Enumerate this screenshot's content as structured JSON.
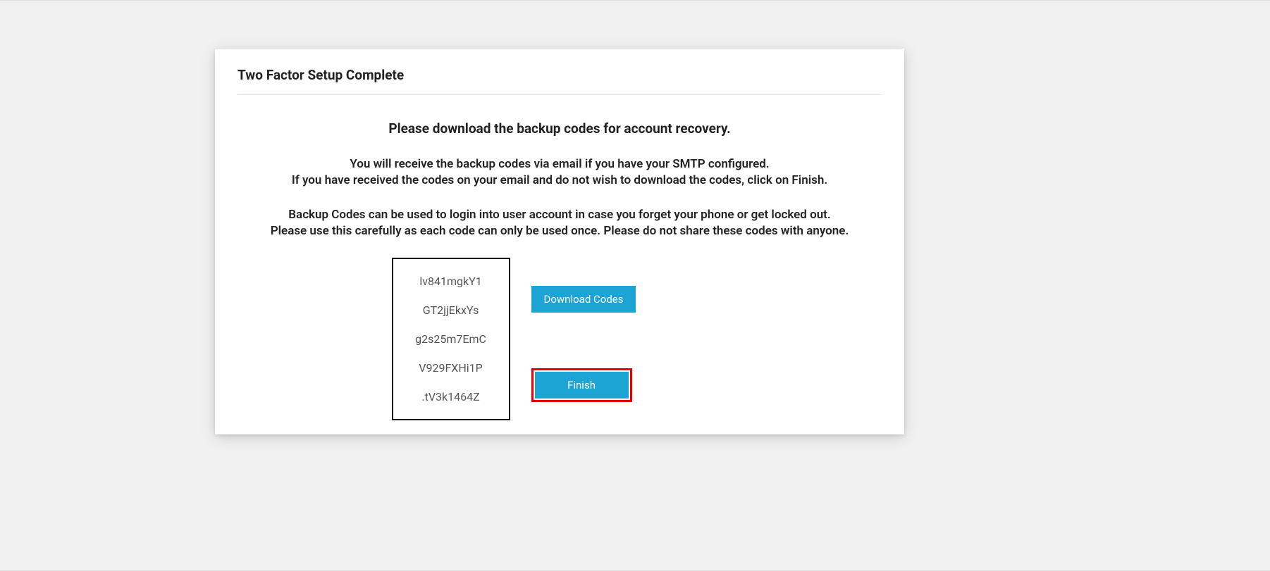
{
  "header": {
    "title": "Two Factor Setup Complete"
  },
  "intro": {
    "heading": "Please download the backup codes for account recovery.",
    "para1_line1": "You will receive the backup codes via email if you have your SMTP configured.",
    "para1_line2": "If you have received the codes on your email and do not wish to download the codes, click on Finish.",
    "para2_line1": "Backup Codes can be used to login into user account in case you forget your phone or get locked out.",
    "para2_line2": "Please use this carefully as each code can only be used once. Please do not share these codes with anyone."
  },
  "codes": [
    "lv841mgkY1",
    "GT2jjEkxYs",
    "g2s25m7EmC",
    "V929FXHi1P",
    ".tV3k1464Z"
  ],
  "buttons": {
    "download": "Download Codes",
    "finish": "Finish"
  }
}
